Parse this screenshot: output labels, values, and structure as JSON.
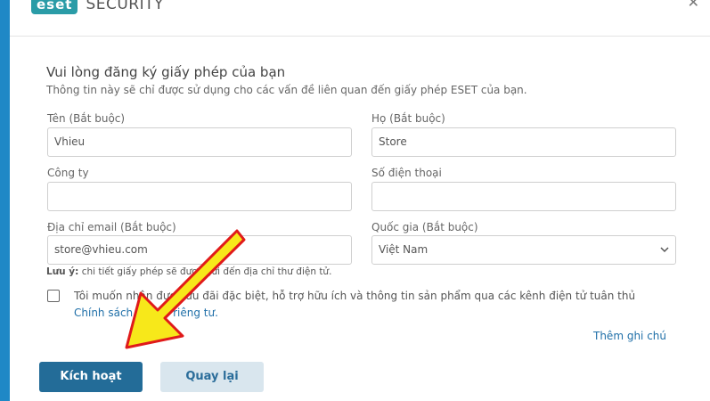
{
  "header": {
    "logo_text": "eset",
    "product": "SECURITY",
    "close_icon": "close-icon"
  },
  "form": {
    "title": "Vui lòng đăng ký giấy phép của bạn",
    "subtitle": "Thông tin này sẽ chỉ được sử dụng cho các vấn đề liên quan đến giấy phép ESET của bạn.",
    "first_name": {
      "label": "Tên (Bắt buộc)",
      "value": "Vhieu"
    },
    "last_name": {
      "label": "Họ (Bắt buộc)",
      "value": "Store"
    },
    "company": {
      "label": "Công ty",
      "value": ""
    },
    "phone": {
      "label": "Số điện thoại",
      "value": ""
    },
    "email": {
      "label": "Địa chỉ email (Bắt buộc)",
      "value": "store@vhieu.com"
    },
    "country": {
      "label": "Quốc gia (Bắt buộc)",
      "value": "Việt Nam"
    },
    "note_bold": "Lưu ý:",
    "note_text": "chi tiết giấy phép sẽ được gửi đến địa chỉ thư điện tử.",
    "consent_text": "Tôi muốn nhận được ưu đãi đặc biệt, hỗ trợ hữu ích và thông tin sản phẩm qua các kênh điện tử tuân thủ",
    "consent_link": "Chính sách quyền riêng tư.",
    "add_note": "Thêm ghi chú"
  },
  "buttons": {
    "activate": "Kích hoạt",
    "back": "Quay lại"
  },
  "colors": {
    "accent": "#1f88c6",
    "primary_button": "#236c98",
    "annotation_arrow": "#f7e81a"
  }
}
